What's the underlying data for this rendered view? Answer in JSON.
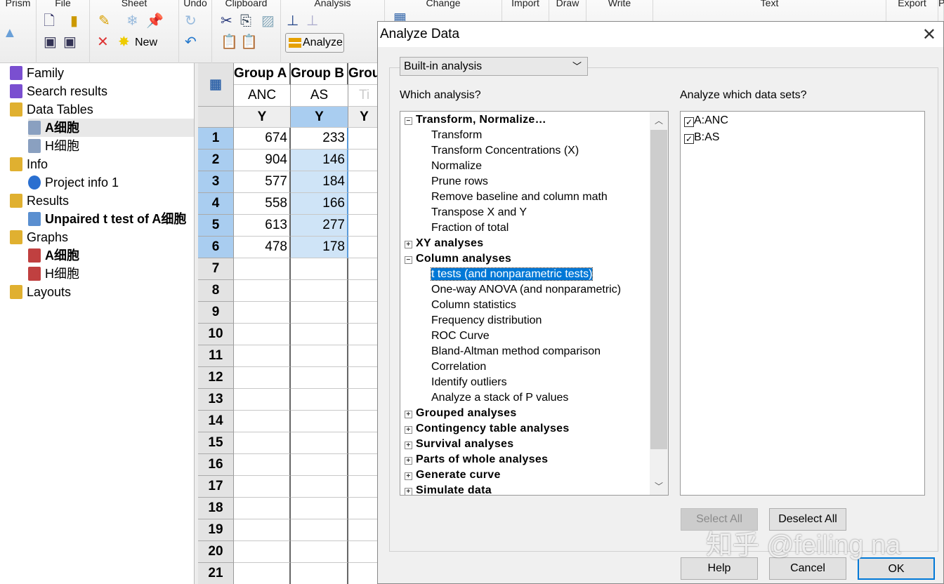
{
  "ribbon": {
    "groups": [
      "Prism",
      "File",
      "Sheet",
      "Undo",
      "Clipboard",
      "Analysis",
      "Change",
      "Import",
      "Draw",
      "Write",
      "Text",
      "Export",
      "P"
    ],
    "analyze_label": "Analyze",
    "new_label": "New"
  },
  "navigator": {
    "items": [
      {
        "label": "Family",
        "level": 0,
        "icon": "book-icon",
        "bold": false
      },
      {
        "label": "Search results",
        "level": 0,
        "icon": "book-icon",
        "bold": false
      },
      {
        "label": "Data Tables",
        "level": 0,
        "icon": "folder-icon",
        "bold": false
      },
      {
        "label": "A细胞",
        "level": 1,
        "icon": "table-icon",
        "bold": true,
        "selected": true
      },
      {
        "label": "H细胞",
        "level": 1,
        "icon": "table-icon",
        "bold": false
      },
      {
        "label": "Info",
        "level": 0,
        "icon": "folder-icon",
        "bold": false
      },
      {
        "label": "Project info 1",
        "level": 1,
        "icon": "info-icon",
        "bold": false
      },
      {
        "label": "Results",
        "level": 0,
        "icon": "folder-icon",
        "bold": false
      },
      {
        "label": "Unpaired t test of A细胞",
        "level": 1,
        "icon": "t-test-icon",
        "bold": true
      },
      {
        "label": "Graphs",
        "level": 0,
        "icon": "folder-icon",
        "bold": false
      },
      {
        "label": "A细胞",
        "level": 1,
        "icon": "graph-icon",
        "bold": true
      },
      {
        "label": "H细胞",
        "level": 1,
        "icon": "graph-icon",
        "bold": false
      },
      {
        "label": "Layouts",
        "level": 0,
        "icon": "folder-icon",
        "bold": false
      }
    ]
  },
  "table": {
    "groups": [
      "Group A",
      "Group B",
      "Grou"
    ],
    "titles": [
      "ANC",
      "AS",
      "Ti"
    ],
    "subcols": [
      "Y",
      "Y",
      "Y"
    ],
    "rows": [
      [
        "674",
        "233"
      ],
      [
        "904",
        "146"
      ],
      [
        "577",
        "184"
      ],
      [
        "558",
        "166"
      ],
      [
        "613",
        "277"
      ],
      [
        "478",
        "178"
      ],
      [
        "",
        ""
      ],
      [
        "",
        ""
      ],
      [
        "",
        ""
      ],
      [
        "",
        ""
      ],
      [
        "",
        ""
      ],
      [
        "",
        ""
      ],
      [
        "",
        ""
      ],
      [
        "",
        ""
      ],
      [
        "",
        ""
      ],
      [
        "",
        ""
      ],
      [
        "",
        ""
      ],
      [
        "",
        ""
      ],
      [
        "",
        ""
      ],
      [
        "",
        ""
      ],
      [
        "",
        ""
      ]
    ]
  },
  "dialog": {
    "title": "Analyze Data",
    "dropdown": "Built-in analysis",
    "which_label": "Which analysis?",
    "datasets_label": "Analyze which data sets?",
    "analyses": [
      {
        "label": "Transform, Normalize…",
        "cat": true,
        "expanded": true
      },
      {
        "label": "Transform"
      },
      {
        "label": "Transform Concentrations (X)"
      },
      {
        "label": "Normalize"
      },
      {
        "label": "Prune rows"
      },
      {
        "label": "Remove baseline and column math"
      },
      {
        "label": "Transpose X and Y"
      },
      {
        "label": "Fraction of total"
      },
      {
        "label": "XY analyses",
        "cat": true,
        "expanded": false
      },
      {
        "label": "Column analyses",
        "cat": true,
        "expanded": true
      },
      {
        "label": "t tests (and nonparametric tests)",
        "selected": true
      },
      {
        "label": "One-way ANOVA (and nonparametric)"
      },
      {
        "label": "Column statistics"
      },
      {
        "label": "Frequency distribution"
      },
      {
        "label": "ROC Curve"
      },
      {
        "label": "Bland-Altman method comparison"
      },
      {
        "label": "Correlation"
      },
      {
        "label": "Identify outliers"
      },
      {
        "label": "Analyze a stack of P values"
      },
      {
        "label": "Grouped analyses",
        "cat": true,
        "expanded": false
      },
      {
        "label": "Contingency table analyses",
        "cat": true,
        "expanded": false
      },
      {
        "label": "Survival analyses",
        "cat": true,
        "expanded": false
      },
      {
        "label": "Parts of whole analyses",
        "cat": true,
        "expanded": false
      },
      {
        "label": "Generate curve",
        "cat": true,
        "expanded": false
      },
      {
        "label": "Simulate data",
        "cat": true,
        "expanded": false
      }
    ],
    "datasets": [
      {
        "label": "A:ANC",
        "checked": true
      },
      {
        "label": "B:AS",
        "checked": true
      }
    ],
    "buttons": {
      "select_all": "Select All",
      "deselect_all": "Deselect All",
      "help": "Help",
      "cancel": "Cancel",
      "ok": "OK"
    }
  },
  "watermark": "知乎 @feiling na",
  "colors": {
    "selection": "#0078d7",
    "column_highlight": "#a9cdf0"
  }
}
